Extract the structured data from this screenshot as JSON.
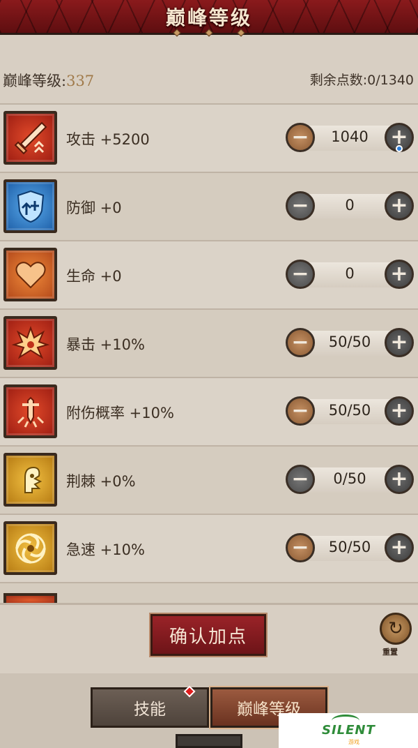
{
  "header": {
    "title": "巅峰等级"
  },
  "info": {
    "level_label": "巅峰等级:",
    "level_value": "337",
    "points_label": "剩余点数:",
    "points_value": "0/1340"
  },
  "stats": [
    {
      "name": "攻击 +5200",
      "value": "1040",
      "icon": "sword-icon",
      "color": "red"
    },
    {
      "name": "防御 +0",
      "value": "0",
      "icon": "shield-icon",
      "color": "blue"
    },
    {
      "name": "生命 +0",
      "value": "0",
      "icon": "heart-icon",
      "color": "orange"
    },
    {
      "name": "暴击 +10%",
      "value": "50/50",
      "icon": "burst-icon",
      "color": "red"
    },
    {
      "name": "附伤概率 +10%",
      "value": "50/50",
      "icon": "dagger-icon",
      "color": "red"
    },
    {
      "name": "荆棘 +0%",
      "value": "0/50",
      "icon": "thorn-icon",
      "color": "gold"
    },
    {
      "name": "急速 +10%",
      "value": "50/50",
      "icon": "swirl-icon",
      "color": "gold"
    }
  ],
  "actions": {
    "confirm_label": "确认加点",
    "reset_label": "重置"
  },
  "tabs": [
    {
      "label": "技能"
    },
    {
      "label": "巅峰等级"
    }
  ],
  "watermark": {
    "text": "SILENT",
    "sub": "游戏"
  }
}
